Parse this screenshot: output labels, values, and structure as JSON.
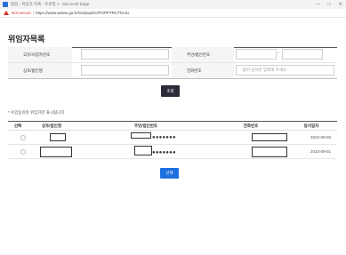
{
  "window": {
    "title": "팝업 - 위임자 목록 - 프로필 1 - Microsoft Edge",
    "controls": [
      "—",
      "□",
      "✕"
    ]
  },
  "address_bar": {
    "security_label": "Not secure",
    "url": "https://www.wetax.go.kr/tcs/pop/trc/POPPTRCTM.do"
  },
  "page": {
    "title": "위임자목록"
  },
  "search_form": {
    "rows": [
      {
        "left_label": "고유/사업자번호",
        "left_value": "",
        "right_label": "주민/법인번호",
        "right_value_1": "",
        "right_value_2": ""
      },
      {
        "left_label": "상호/법인명",
        "left_value": "",
        "right_label": "전화번호",
        "right_placeholder": "- 없이 숫자만 입력해 주세요"
      }
    ],
    "search_button": "조회"
  },
  "note": "* 수임동의된 위임자만 표시됩니다.",
  "table": {
    "headers": [
      "선택",
      "상호/법인명",
      "주민/법인번호",
      "전화번호",
      "동의일자"
    ],
    "rows": [
      {
        "name": "",
        "id_masked": "●●●●●●●",
        "phone": "",
        "date": "2023-09-05"
      },
      {
        "name": "",
        "id_masked": "●●●●●●●",
        "phone": "",
        "date": "2023-09-01"
      }
    ]
  },
  "select_button": "선택",
  "colors": {
    "search_button": "#2b2b3a",
    "select_button": "#1e6fe0",
    "not_secure": "#d93025"
  }
}
